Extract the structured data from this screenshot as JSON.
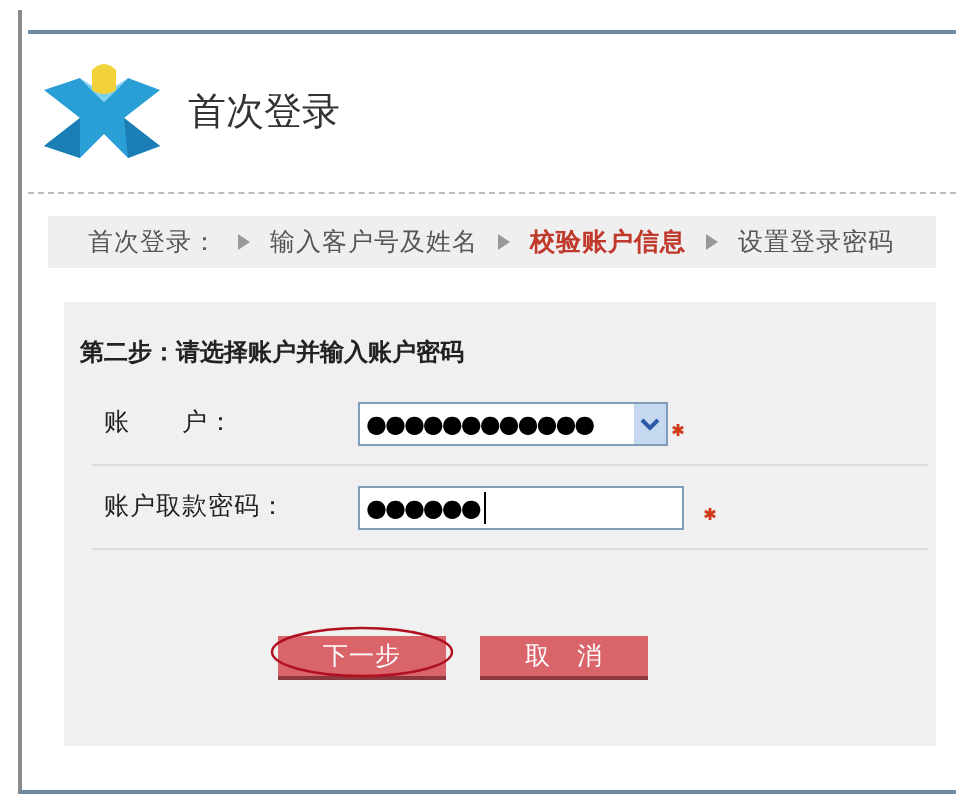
{
  "header": {
    "title": "首次登录"
  },
  "breadcrumb": {
    "label": "首次登录：",
    "steps": [
      {
        "label": "输入客户号及姓名",
        "selected": false
      },
      {
        "label": "校验账户信息",
        "selected": true
      },
      {
        "label": "设置登录密码",
        "selected": false
      }
    ]
  },
  "form": {
    "heading": "第二步：请选择账户并输入账户密码",
    "fields": [
      {
        "kind": "select",
        "label": "账　　户：",
        "value": "●●●●●●●●●●●●",
        "required": true
      },
      {
        "kind": "password",
        "label": "账户取款密码：",
        "value": "●●●●●●",
        "required": true
      }
    ],
    "buttons": [
      {
        "label": "下一步",
        "highlighted": true
      },
      {
        "label": "取　消",
        "highlighted": false
      }
    ]
  }
}
